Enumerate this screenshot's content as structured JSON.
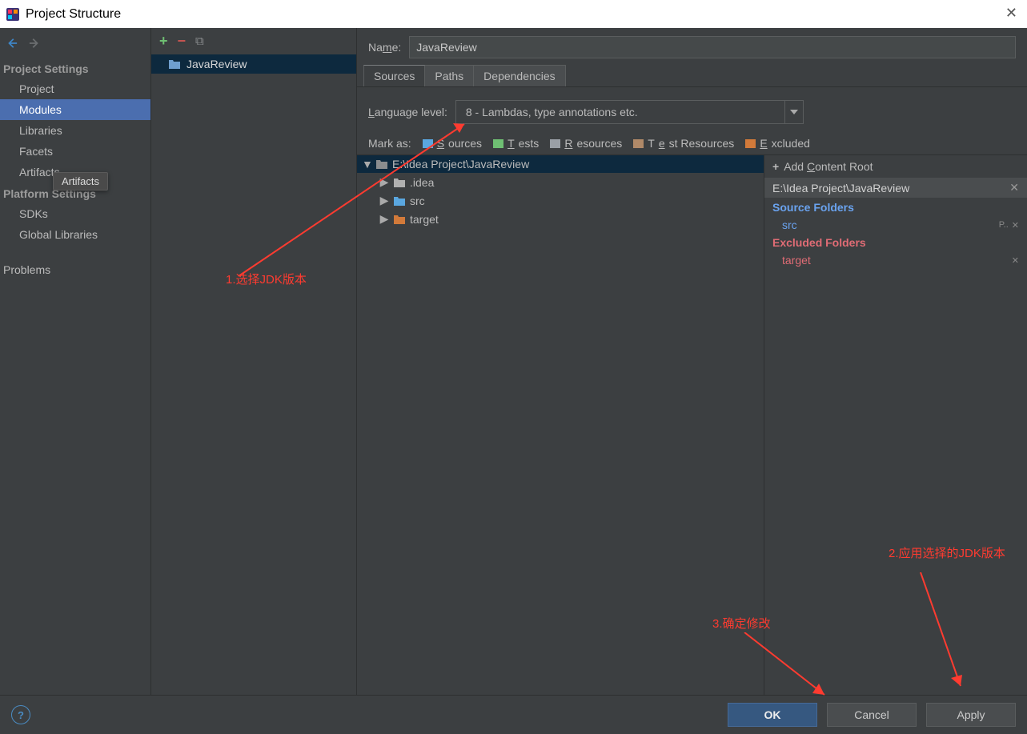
{
  "window": {
    "title": "Project Structure"
  },
  "sidebar": {
    "nav_back": "←",
    "nav_fwd": "→",
    "section1": "Project Settings",
    "items1": [
      "Project",
      "Modules",
      "Libraries",
      "Facets",
      "Artifacts"
    ],
    "section2": "Platform Settings",
    "items2": [
      "SDKs",
      "Global Libraries"
    ],
    "problems": "Problems",
    "tooltip": "Artifacts"
  },
  "modules": {
    "toolbar": {
      "add": "+",
      "remove": "−",
      "copy": "⧉"
    },
    "list": [
      {
        "name": "JavaReview"
      }
    ]
  },
  "main": {
    "name_label": "Name:",
    "name_value": "JavaReview",
    "tabs": [
      "Sources",
      "Paths",
      "Dependencies"
    ],
    "lang_label": "Language level:",
    "lang_value": "8 - Lambdas, type annotations etc.",
    "mark_label": "Mark as:",
    "mark_items": [
      "Sources",
      "Tests",
      "Resources",
      "Test Resources",
      "Excluded"
    ],
    "tree": {
      "root": "E:\\Idea Project\\JavaReview",
      "children": [
        {
          "name": ".idea",
          "color": "#b0b0b0"
        },
        {
          "name": "src",
          "color": "#5aa7e0"
        },
        {
          "name": "target",
          "color": "#d27a3a"
        }
      ]
    },
    "folders_pane": {
      "add_root": "Add Content Root",
      "root_path": "E:\\Idea Project\\JavaReview",
      "source_header": "Source Folders",
      "source_items": [
        "src"
      ],
      "excluded_header": "Excluded Folders",
      "excluded_items": [
        "target"
      ]
    }
  },
  "footer": {
    "ok": "OK",
    "cancel": "Cancel",
    "apply": "Apply"
  },
  "annotations": {
    "a1": "1.选择JDK版本",
    "a2": "2.应用选择的JDK版本",
    "a3": "3.确定修改"
  },
  "colors": {
    "mark": {
      "sources": "#5aa7e0",
      "tests": "#6fbf73",
      "resources": "#9aa0a6",
      "test_resources": "#b08968",
      "excluded": "#d27a3a"
    }
  }
}
